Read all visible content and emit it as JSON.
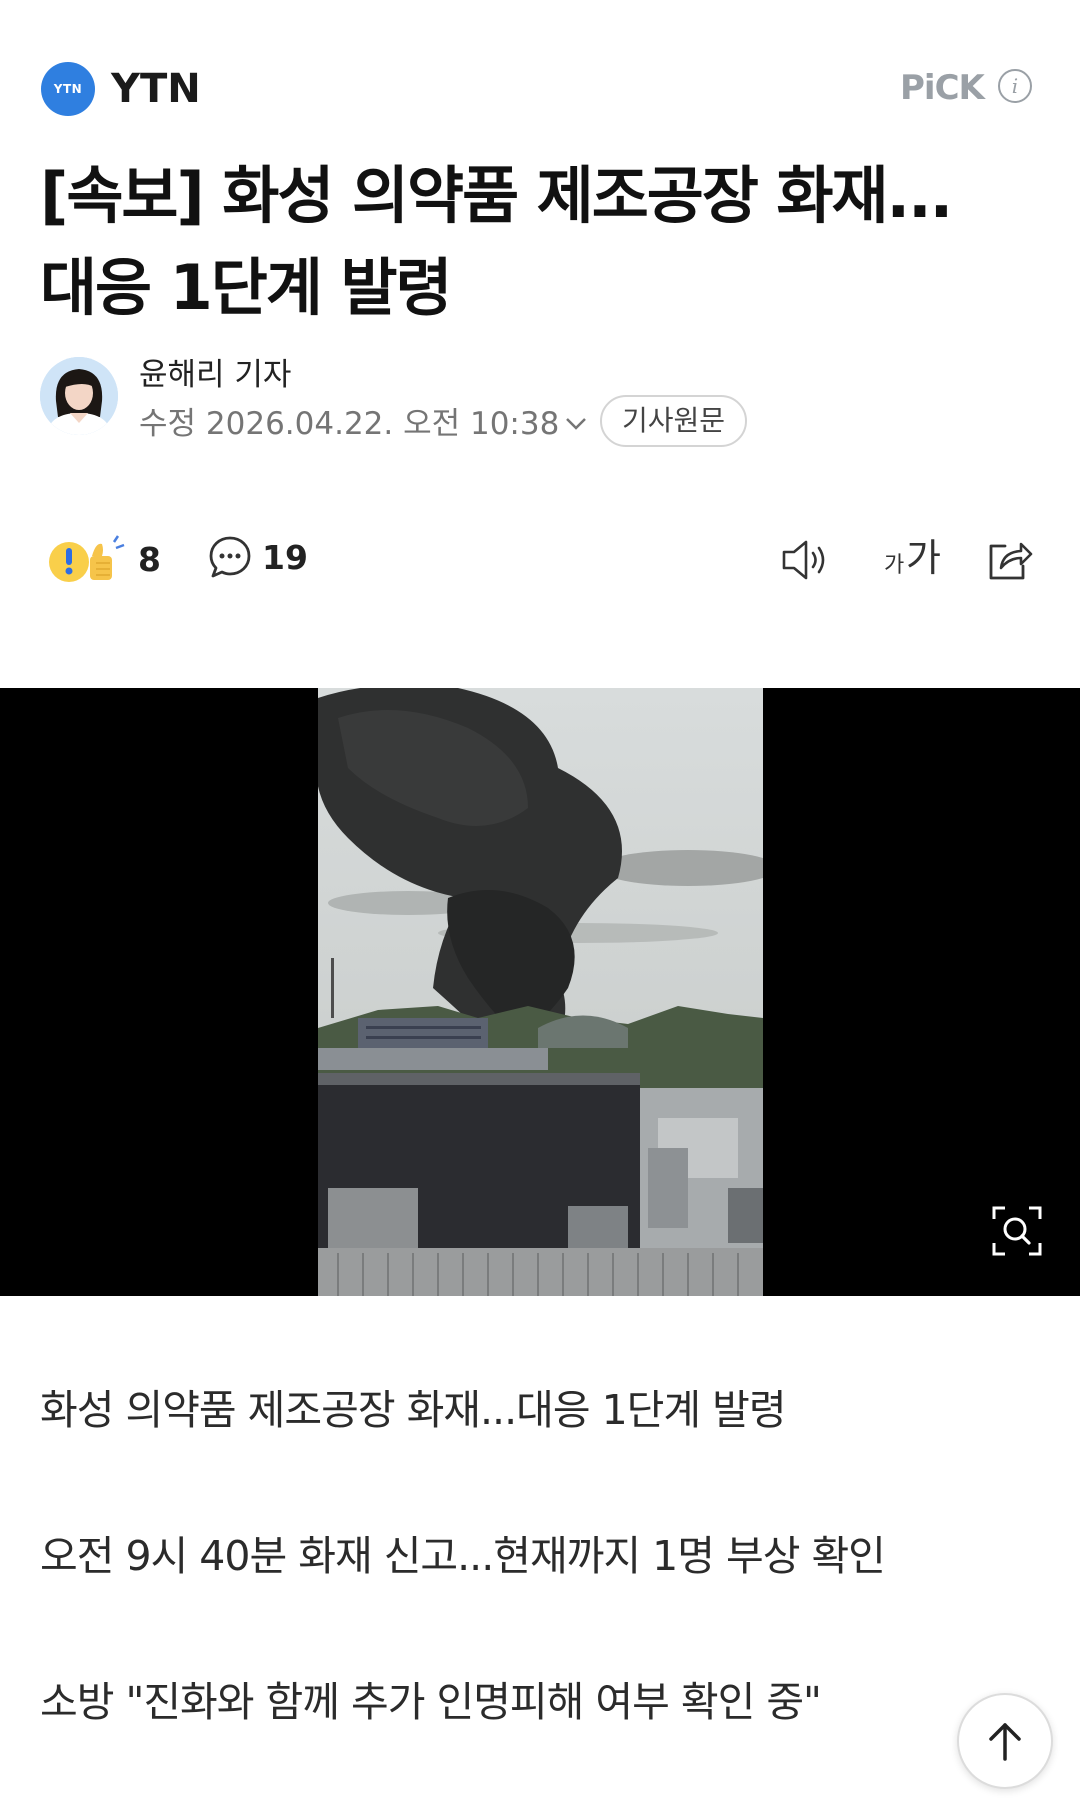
{
  "header": {
    "press_logo_text": "YTN",
    "press_name": "YTN",
    "pick_label": "PiCK"
  },
  "article": {
    "headline_line1": "[속보] 화성 의약품 제조공장 화재...",
    "headline_line2": "대응 1단계 발령",
    "reporter": "윤해리 기자",
    "date": "수정 2026.04.22. 오전 10:38",
    "source_button": "기사원문"
  },
  "toolbar": {
    "reaction_count": "8",
    "comment_count": "19",
    "font_small": "가",
    "font_large": "가"
  },
  "summary": [
    "화성 의약품 제조공장 화재...대응 1단계 발령",
    "오전 9시 40분 화재 신고...현재까지 1명 부상 확인",
    "소방 \"진화와 함께 추가 인명피해 여부 확인 중\""
  ],
  "colors": {
    "press_logo_bg": "#2f7fe0",
    "pick_gray": "#9aa0a6",
    "media_bg": "#000000"
  },
  "icons": [
    "info-icon",
    "chevron-down-icon",
    "reaction-icon",
    "comment-icon",
    "speaker-icon",
    "font-size-icon",
    "share-icon",
    "zoom-icon",
    "arrow-up-icon"
  ]
}
